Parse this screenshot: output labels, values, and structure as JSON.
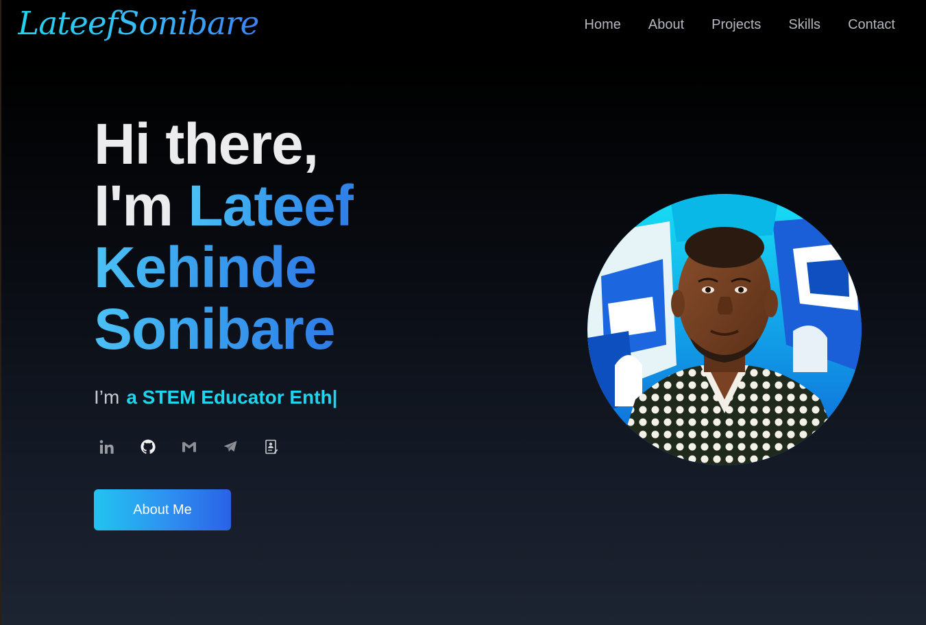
{
  "header": {
    "logo_text": "LateefSonibare",
    "nav": [
      "Home",
      "About",
      "Projects",
      "Skills",
      "Contact"
    ]
  },
  "hero": {
    "greeting": "Hi there,",
    "im": "I'm ",
    "name_line1": "Lateef",
    "name_line2": "Kehinde",
    "name_line3": "Sonibare",
    "tagline_prefix": "I’m",
    "tagline_typed": "a STEM Educator Enth",
    "tagline_cursor": "|",
    "cta_label": "About Me"
  },
  "socials": [
    "linkedin-icon",
    "github-icon",
    "gmail-icon",
    "telegram-icon",
    "resume-icon"
  ],
  "colors": {
    "accent_cyan": "#22d3ee",
    "accent_blue": "#3b82f6",
    "nav_text": "#b5b8bf",
    "background_top": "#000000",
    "background_bottom": "#1d2431"
  }
}
